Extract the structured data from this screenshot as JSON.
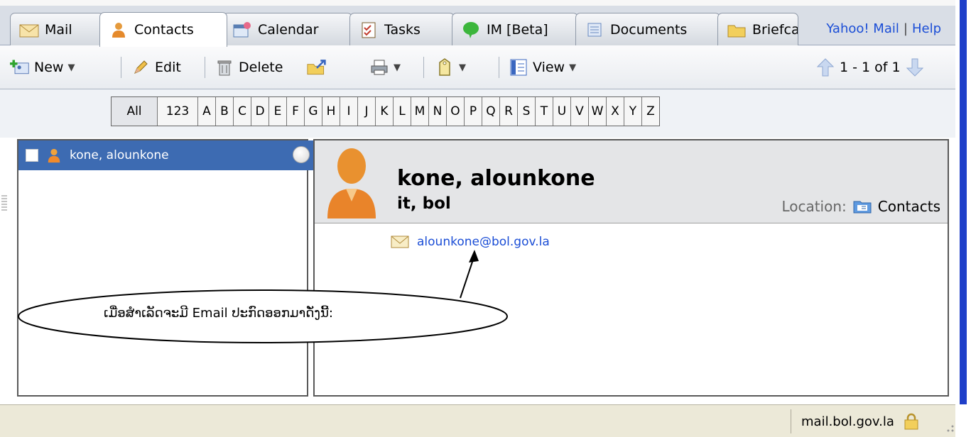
{
  "tabs": [
    {
      "label": "Mail"
    },
    {
      "label": "Contacts"
    },
    {
      "label": "Calendar"
    },
    {
      "label": "Tasks"
    },
    {
      "label": "IM [Beta]"
    },
    {
      "label": "Documents"
    },
    {
      "label": "Briefcase"
    }
  ],
  "header_links": {
    "yahoo": "Yahoo! Mail",
    "sep": "|",
    "help": "Help"
  },
  "toolbar": {
    "new_label": "New",
    "edit_label": "Edit",
    "delete_label": "Delete",
    "view_label": "View",
    "pager": "1 - 1 of 1"
  },
  "alpha": {
    "items": [
      "All",
      "123",
      "A",
      "B",
      "C",
      "D",
      "E",
      "F",
      "G",
      "H",
      "I",
      "J",
      "K",
      "L",
      "M",
      "N",
      "O",
      "P",
      "Q",
      "R",
      "S",
      "T",
      "U",
      "V",
      "W",
      "X",
      "Y",
      "Z"
    ]
  },
  "list": {
    "items": [
      {
        "name": "kone, alounkone"
      }
    ]
  },
  "detail": {
    "name": "kone, alounkone",
    "org": "it, bol",
    "location_label": "Location:",
    "location_value": "Contacts",
    "email": "alounkone@bol.gov.la"
  },
  "annotation": {
    "text": "ເມື່ອສໍາເລັດຈະມີ Email ປະກົດອອກມາດັ່ງນີ້:"
  },
  "status": {
    "host": "mail.bol.gov.la"
  },
  "colors": {
    "selected_row": "#3d6bb2",
    "link": "#1a4dd6",
    "right_bar": "#1f3fc9"
  }
}
